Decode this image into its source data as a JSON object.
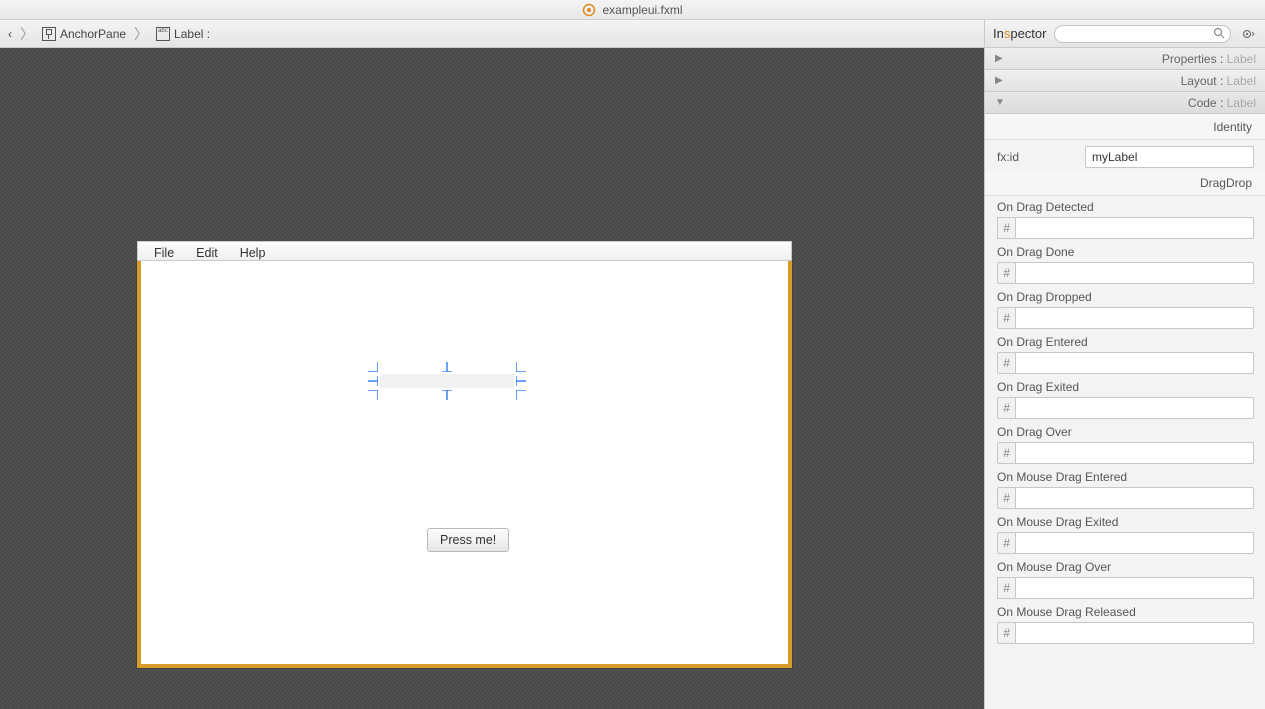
{
  "titlebar": {
    "filename": "exampleui.fxml"
  },
  "breadcrumb": {
    "ellipsis": "‹",
    "items": [
      {
        "label": "AnchorPane"
      },
      {
        "label": "Label :"
      }
    ]
  },
  "preview": {
    "menu": {
      "file": "File",
      "edit": "Edit",
      "help": "Help"
    },
    "button_label": "Press me!"
  },
  "inspector": {
    "title_pre": "In",
    "title_accent": "s",
    "title_post": "pector",
    "search_placeholder": "",
    "sections": {
      "properties": {
        "key": "Properties",
        "value": "Label"
      },
      "layout": {
        "key": "Layout",
        "value": "Label"
      },
      "code": {
        "key": "Code",
        "value": "Label"
      }
    },
    "identity_header": "Identity",
    "fxid_label": "fx:id",
    "fxid_value": "myLabel",
    "dragdrop_header": "DragDrop",
    "events": [
      {
        "label": "On Drag Detected",
        "value": ""
      },
      {
        "label": "On Drag Done",
        "value": ""
      },
      {
        "label": "On Drag Dropped",
        "value": ""
      },
      {
        "label": "On Drag Entered",
        "value": ""
      },
      {
        "label": "On Drag Exited",
        "value": ""
      },
      {
        "label": "On Drag Over",
        "value": ""
      },
      {
        "label": "On Mouse Drag Entered",
        "value": ""
      },
      {
        "label": "On Mouse Drag Exited",
        "value": ""
      },
      {
        "label": "On Mouse Drag Over",
        "value": ""
      },
      {
        "label": "On Mouse Drag Released",
        "value": ""
      }
    ],
    "hash": "#"
  }
}
